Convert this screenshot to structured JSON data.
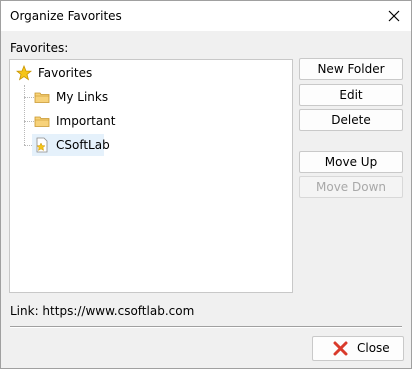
{
  "window": {
    "title": "Organize Favorites"
  },
  "favorites_label": "Favorites:",
  "tree": {
    "root": {
      "label": "Favorites",
      "icon": "star-icon"
    },
    "children": [
      {
        "label": "My Links",
        "icon": "folder-icon"
      },
      {
        "label": "Important",
        "icon": "folder-icon"
      },
      {
        "label": "CSoftLab",
        "icon": "bookmark-page-icon",
        "selected": true
      }
    ]
  },
  "buttons": {
    "new_folder": "New Folder",
    "edit": "Edit",
    "delete": "Delete",
    "move_up": "Move Up",
    "move_down": "Move Down"
  },
  "link": {
    "text": "Link: https://www.csoftlab.com"
  },
  "footer": {
    "close_label": "Close"
  },
  "colors": {
    "selection": "#e5f1fb",
    "star": "#f5c518",
    "folder": "#e8b64a",
    "close_x": "#d93a2b"
  }
}
